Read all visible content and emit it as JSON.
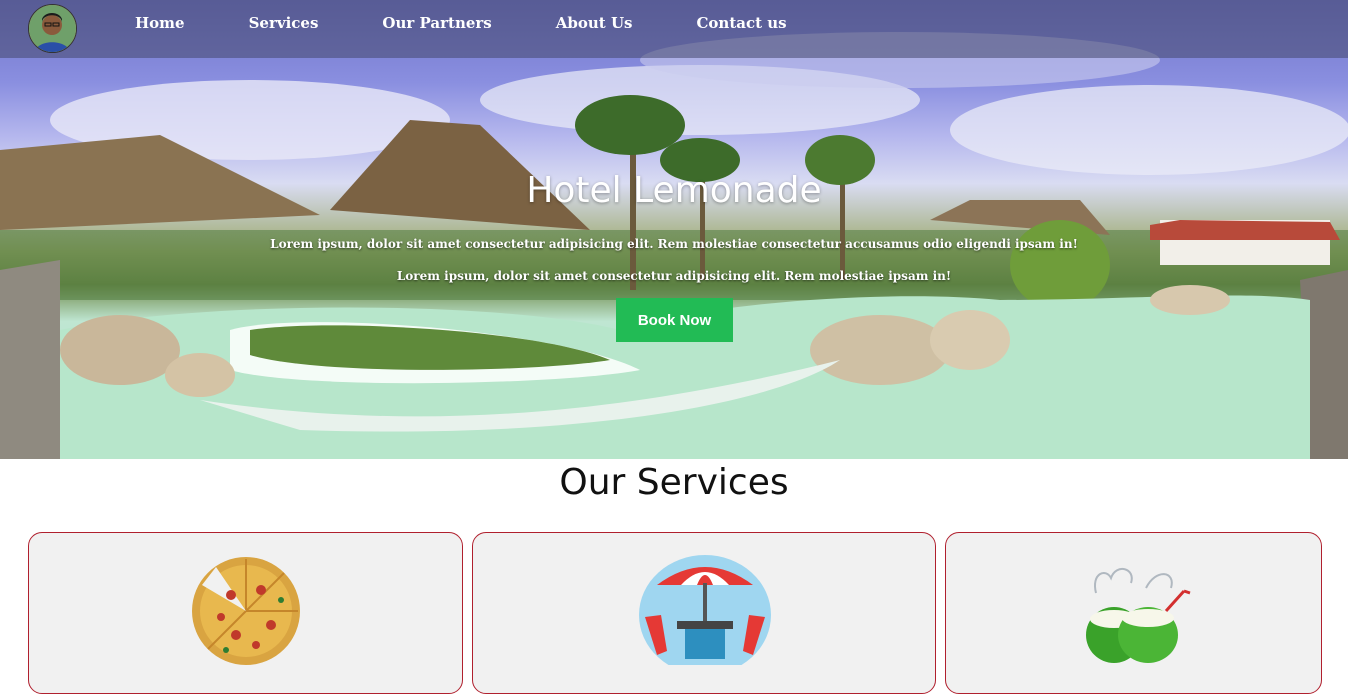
{
  "nav": {
    "avatar": "profile-avatar",
    "links": [
      "Home",
      "Services",
      "Our Partners",
      "About Us",
      "Contact us"
    ]
  },
  "hero": {
    "title": "Hotel Lemonade",
    "line1": "Lorem ipsum, dolor sit amet consectetur adipisicing elit. Rem molestiae consectetur accusamus odio eligendi ipsam in!",
    "line2": "Lorem ipsum, dolor sit amet consectetur adipisicing elit. Rem molestiae ipsam in!",
    "button": "Book Now",
    "button_color": "#22bb55"
  },
  "services": {
    "title": "Our Services",
    "cards": [
      {
        "icon": "pizza-icon"
      },
      {
        "icon": "umbrella-table-icon"
      },
      {
        "icon": "coconut-drink-icon"
      }
    ]
  },
  "colors": {
    "card_border": "#b0202e",
    "card_background": "#f1f1f1"
  }
}
